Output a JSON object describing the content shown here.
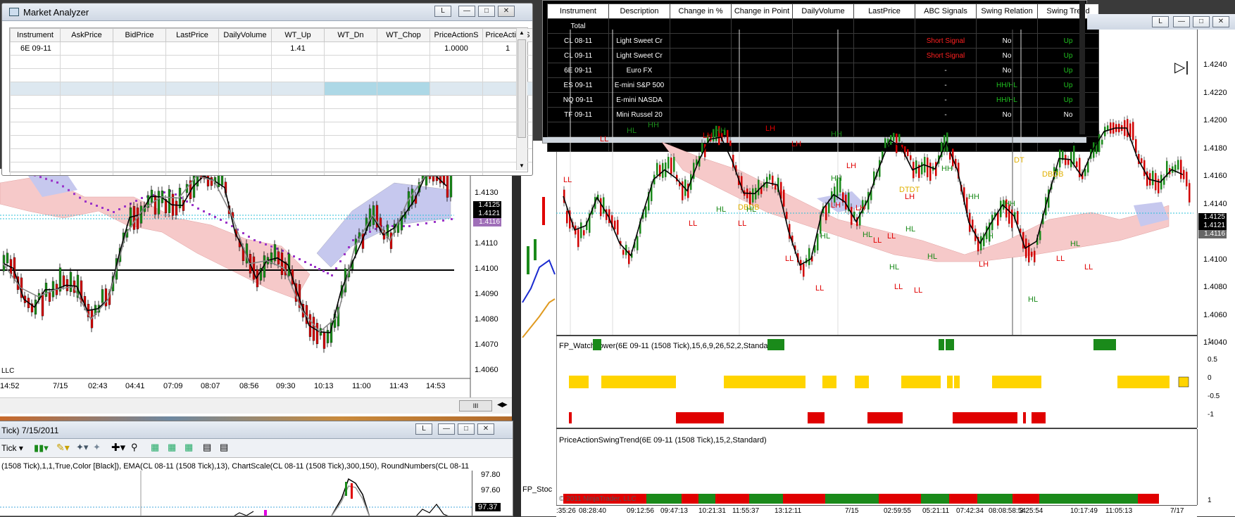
{
  "market_analyzer": {
    "title": "Market Analyzer",
    "link_label": "L",
    "columns": [
      "Instrument",
      "AskPrice",
      "BidPrice",
      "LastPrice",
      "DailyVolume",
      "WT_Up",
      "WT_Dn",
      "WT_Chop",
      "PriceActionS",
      "PriceActionS"
    ],
    "rows": [
      [
        "6E 09-11",
        "",
        "",
        "",
        "",
        "1.41",
        "",
        "",
        "1.0000",
        "1"
      ]
    ]
  },
  "top_table": {
    "columns": [
      "Instrument",
      "Description",
      "Change in %",
      "Change in Point",
      "DailyVolume",
      "LastPrice",
      "ABC Signals",
      "Swing Relation",
      "Swing Trend"
    ],
    "total_label": "Total",
    "rows": [
      [
        "CL 08-11",
        "Light Sweet Cr",
        "",
        "",
        "",
        "",
        "Short Signal",
        "No",
        "Up"
      ],
      [
        "CL 09-11",
        "Light Sweet Cr",
        "",
        "",
        "",
        "",
        "Short Signal",
        "No",
        "Up"
      ],
      [
        "6E 09-11",
        "Euro FX",
        "",
        "",
        "",
        "",
        "-",
        "No",
        "Up"
      ],
      [
        "ES 09-11",
        "E-mini S&P 500",
        "",
        "",
        "",
        "",
        "-",
        "HH/HL",
        "Up"
      ],
      [
        "NQ 09-11",
        "E-mini NASDA",
        "",
        "",
        "",
        "",
        "-",
        "HH/HL",
        "Up"
      ],
      [
        "TF 09-11",
        "Mini Russel 20",
        "",
        "",
        "",
        "",
        "-",
        "No",
        "No"
      ]
    ]
  },
  "left_chart": {
    "price_labels": [
      "1.4130",
      "1.4120",
      "1.4110",
      "1.4100",
      "1.4090",
      "1.4080",
      "1.4070",
      "1.4060"
    ],
    "tags": [
      "1.4125",
      "1.4121",
      "1.4116"
    ],
    "time_labels": [
      "14:52",
      "7/15",
      "02:43",
      "04:41",
      "07:09",
      "08:07",
      "08:56",
      "09:30",
      "10:13",
      "11:00",
      "11:43",
      "14:53"
    ],
    "corner_text": "LLC",
    "scroll_label": "III"
  },
  "bottom_chart": {
    "window_title": "Tick) 7/15/2011",
    "link_label": "L",
    "toolbar_label": "Tick",
    "indicator_text": "(1508 Tick),1,1,True,Color [Black]), EMA(CL 08-11 (1508 Tick),13), ChartScale(CL 08-11 (1508 Tick),300,150), RoundNumbers(CL 08-11",
    "price_labels": [
      "97.80",
      "97.60"
    ],
    "tag": "97.37"
  },
  "middle_strip": {
    "text": "FP_Stoc"
  },
  "right_chart": {
    "link_label": "L",
    "price_labels": [
      "1.4240",
      "1.4220",
      "1.4200",
      "1.4180",
      "1.4160",
      "1.4140",
      "1.4120",
      "1.4100",
      "1.4080",
      "1.4060",
      "1.4040"
    ],
    "tags": [
      "1.4125",
      "1.4121",
      "1.4116"
    ],
    "swing_labels": [
      {
        "text": "LL",
        "color": "#e00000"
      },
      {
        "text": "LL",
        "color": "#e00000"
      },
      {
        "text": "HL",
        "color": "#1a8a1a"
      },
      {
        "text": "LH",
        "color": "#e00000"
      },
      {
        "text": "HH",
        "color": "#1a8a1a"
      },
      {
        "text": "HH",
        "color": "#1a8a1a"
      },
      {
        "text": "HL",
        "color": "#1a8a1a"
      },
      {
        "text": "DBDB",
        "color": "#e0b000"
      },
      {
        "text": "LL",
        "color": "#e00000"
      },
      {
        "text": "LL",
        "color": "#e00000"
      },
      {
        "text": "LH",
        "color": "#e00000"
      },
      {
        "text": "HL",
        "color": "#1a8a1a"
      },
      {
        "text": "LL",
        "color": "#e00000"
      },
      {
        "text": "LH",
        "color": "#e00000"
      },
      {
        "text": "HH",
        "color": "#1a8a1a"
      },
      {
        "text": "HH",
        "color": "#1a8a1a"
      },
      {
        "text": "LH",
        "color": "#e00000"
      },
      {
        "text": "LH",
        "color": "#e00000"
      },
      {
        "text": "LL",
        "color": "#e00000"
      },
      {
        "text": "HL",
        "color": "#1a8a1a"
      },
      {
        "text": "HL",
        "color": "#1a8a1a"
      },
      {
        "text": "LL",
        "color": "#e00000"
      },
      {
        "text": "DTDT",
        "color": "#e0b000"
      },
      {
        "text": "LH",
        "color": "#e00000"
      },
      {
        "text": "LL",
        "color": "#e00000"
      },
      {
        "text": "HL",
        "color": "#1a8a1a"
      },
      {
        "text": "LH",
        "color": "#e00000"
      },
      {
        "text": "HH",
        "color": "#1a8a1a"
      },
      {
        "text": "HL",
        "color": "#1a8a1a"
      },
      {
        "text": "LL",
        "color": "#e00000"
      },
      {
        "text": "LL",
        "color": "#e00000"
      },
      {
        "text": "HL",
        "color": "#1a8a1a"
      },
      {
        "text": "HH",
        "color": "#1a8a1a"
      },
      {
        "text": "HH",
        "color": "#1a8a1a"
      },
      {
        "text": "HH",
        "color": "#1a8a1a"
      },
      {
        "text": "LH",
        "color": "#e00000"
      },
      {
        "text": "DT",
        "color": "#e0b000"
      },
      {
        "text": "HL",
        "color": "#1a8a1a"
      },
      {
        "text": "DBDB",
        "color": "#e0b000"
      },
      {
        "text": "LL",
        "color": "#e00000"
      },
      {
        "text": "HL",
        "color": "#1a8a1a"
      },
      {
        "text": "LL",
        "color": "#e00000"
      }
    ],
    "indicator1_title": "FP_WatchTower(6E 09-11 (1508 Tick),15,6,9,26,52,2,Standard)",
    "indicator1_scale": [
      "1",
      "0.5",
      "0",
      "-0.5",
      "-1"
    ],
    "indicator2_title": "PriceActionSwingTrend(6E 09-11 (1508 Tick),15,2,Standard)",
    "indicator2_scale": [
      "1"
    ],
    "copyright": "© 2011 NinjaTrader, LLC",
    "time_labels": [
      ":35:26",
      "08:28:40",
      "09:12:56",
      "09:47:13",
      "10:21:31",
      "11:55:37",
      "13:12:11",
      "7/15",
      "02:59:55",
      "05:21:11",
      "07:42:34",
      "08:08:58:54",
      "3:25:54",
      "10:17:49",
      "11:05:13",
      "7/17"
    ]
  },
  "colors": {
    "bull": "#1a8a1a",
    "bear": "#e00000",
    "neutral": "#ffd400",
    "cloud_bear": "#f6c9c9",
    "cloud_bull": "#c6c8ee",
    "tag_bg": "#000000"
  }
}
